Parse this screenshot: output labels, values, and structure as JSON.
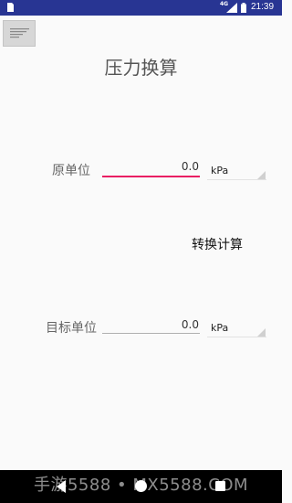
{
  "status_bar": {
    "network_label": "4G",
    "time": "21:39"
  },
  "title": "压力换算",
  "source": {
    "label": "原单位",
    "value": "0.0",
    "unit": "kPa"
  },
  "convert_button": "转换计算",
  "target": {
    "label": "目标单位",
    "value": "0.0",
    "unit": "kPa"
  },
  "watermark": "手游5588 • MX5588.COM",
  "colors": {
    "status_bar": "#283593",
    "accent": "#e91e63",
    "background": "#fafafa"
  }
}
